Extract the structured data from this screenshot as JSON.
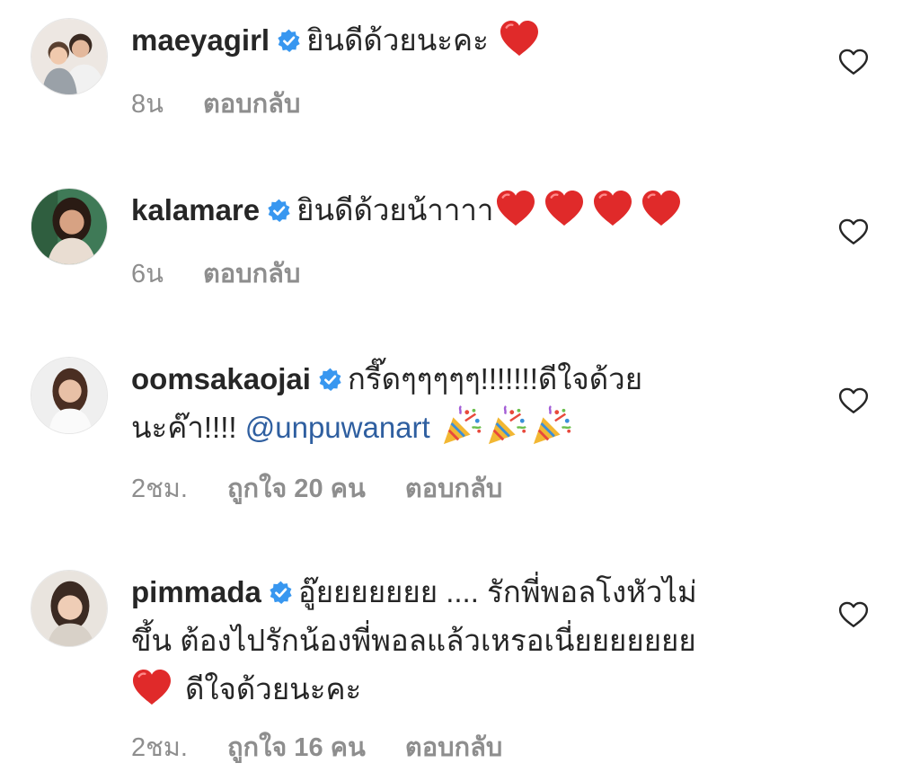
{
  "comments": [
    {
      "username": "maeyagirl",
      "text": "ยินดีด้วยนะคะ",
      "time": "8น",
      "reply_label": "ตอบกลับ"
    },
    {
      "username": "kalamare",
      "text": "ยินดีด้วยน้าาาา",
      "time": "6น",
      "reply_label": "ตอบกลับ"
    },
    {
      "username": "oomsakaojai",
      "text_line1": "กรี๊ดๆๆๆๆๆ!!!!!!!ดีใจด้วย",
      "text_line2": "นะค๊า!!!!",
      "mention": "@unpuwanart",
      "time": "2ชม.",
      "likes": "ถูกใจ 20 คน",
      "reply_label": "ตอบกลับ"
    },
    {
      "username": "pimmada",
      "text_line1": "อู๊ยยยยยยย .... รักพี่พอลโงหัวไม่",
      "text_line2": "ขึ้น ต้องไปรักน้องพี่พอลแล้วเหรอเนี่ยยยยยยย",
      "text_line3": "ดีใจด้วยนะคะ",
      "time": "2ชม.",
      "likes": "ถูกใจ 16 คน",
      "reply_label": "ตอบกลับ"
    }
  ],
  "icons": {
    "verified": "verified-badge-icon",
    "heart_emoji": "red-heart-emoji",
    "party_emoji": "party-popper-emoji",
    "like": "heart-outline-icon"
  },
  "colors": {
    "text": "#262626",
    "meta": "#8e8e8e",
    "verified": "#3897f0",
    "heart": "#e02a2a",
    "mention": "#2f5fa0"
  }
}
